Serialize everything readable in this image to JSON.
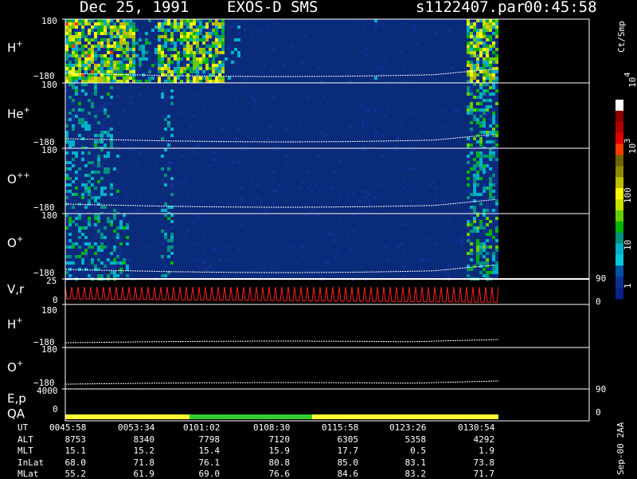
{
  "header": {
    "date": "Dec 25, 1991",
    "instrument": "EXOS-D SMS",
    "file": "s1122407.par",
    "start_time": "00:45:58"
  },
  "colors": {
    "background": "#000000",
    "spectrogram_bg": "#0a2a7a",
    "red_trace": "#ff2020",
    "yellow_qa": "#ffff33",
    "green_qa": "#33cc33"
  },
  "colorbar": {
    "title": "Ct/Smp",
    "tick_labels": [
      "1",
      "10",
      "100",
      "10",
      "10"
    ],
    "tick_exponents": [
      "",
      "",
      "",
      "3",
      "4"
    ],
    "colors": [
      "#ffffff",
      "#8b0000",
      "#b00000",
      "#e00000",
      "#ff3b00",
      "#706000",
      "#8b8a00",
      "#bcbc00",
      "#ffff00",
      "#c8e000",
      "#66cc00",
      "#00b400",
      "#009080",
      "#00b0c8",
      "#00c8d8",
      "#0050a0",
      "#103090",
      "#0a1f8a"
    ]
  },
  "panels": [
    {
      "name": "H",
      "sup": "+",
      "top_tick": "180",
      "bottom_tick": "−180"
    },
    {
      "name": "He",
      "sup": "+",
      "top_tick": "180",
      "bottom_tick": "−180"
    },
    {
      "name": "O",
      "sup": "++",
      "top_tick": "180",
      "bottom_tick": "−180"
    },
    {
      "name": "O",
      "sup": "+",
      "top_tick": "180",
      "bottom_tick": "−180"
    },
    {
      "name": "V,r",
      "sup": "",
      "top_tick": "25",
      "bottom_tick": "0",
      "right_top": "90",
      "right_bottom": "0"
    },
    {
      "name": "H",
      "sup": "+",
      "top_tick": "180",
      "bottom_tick": "−180"
    },
    {
      "name": "O",
      "sup": "+",
      "top_tick": "180",
      "bottom_tick": "−180"
    },
    {
      "name": "E,p",
      "sup": "",
      "top_tick": "4000",
      "bottom_tick": "0",
      "right_top": "90",
      "right_bottom": "0"
    }
  ],
  "qa_label": "QA",
  "footer_note": "Sep-00 2AA",
  "table": {
    "row_labels": [
      "UT",
      "ALT",
      "MLT",
      "InLat",
      "MLat"
    ],
    "columns": [
      [
        "0045:58",
        "8753",
        "15.1",
        "68.0",
        "55.2"
      ],
      [
        "0053:34",
        "8340",
        "15.2",
        "71.8",
        "61.9"
      ],
      [
        "0101:02",
        "7798",
        "15.4",
        "76.1",
        "69.0"
      ],
      [
        "0108:30",
        "7120",
        "15.9",
        "80.8",
        "76.6"
      ],
      [
        "0115:58",
        "6305",
        "17.7",
        "85.0",
        "84.6"
      ],
      [
        "0123:26",
        "5358",
        "0.5",
        "83.1",
        "83.2"
      ],
      [
        "0130:54",
        "4292",
        "1.9",
        "73.8",
        "71.7"
      ]
    ]
  },
  "chart_data": {
    "type": "heatmap",
    "title": "Dec 25, 1991   EXOS-D SMS",
    "x_ticks": [
      "0045:58",
      "0053:34",
      "0101:02",
      "0108:30",
      "0115:58",
      "0123:26",
      "0130:54"
    ],
    "series": [
      {
        "name": "H+",
        "yrange": [
          -180,
          180
        ]
      },
      {
        "name": "He+",
        "yrange": [
          -180,
          180
        ]
      },
      {
        "name": "O++",
        "yrange": [
          -180,
          180
        ]
      },
      {
        "name": "O+",
        "yrange": [
          -180,
          180
        ]
      },
      {
        "name": "V,r",
        "yrange": [
          0,
          25
        ]
      },
      {
        "name": "H+",
        "yrange": [
          -180,
          180
        ]
      },
      {
        "name": "O+",
        "yrange": [
          -180,
          180
        ]
      },
      {
        "name": "E,p",
        "yrange": [
          0,
          4000
        ]
      }
    ],
    "colorbar_range": [
      1,
      10000
    ],
    "colorbar_scale": "log"
  }
}
